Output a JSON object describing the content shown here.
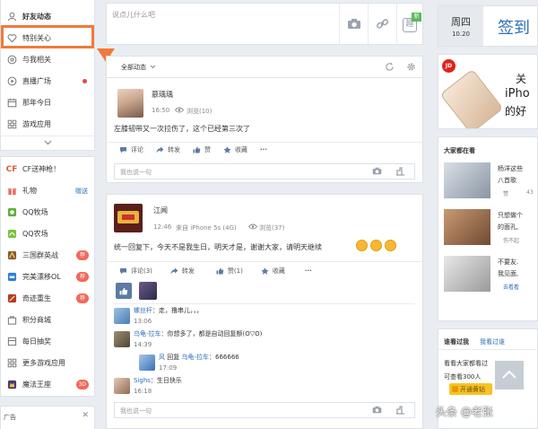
{
  "nav": {
    "items": [
      {
        "label": "好友动态"
      },
      {
        "label": "特别关心"
      },
      {
        "label": "与我相关"
      },
      {
        "label": "直播广场"
      },
      {
        "label": "那年今日"
      },
      {
        "label": "游戏应用"
      }
    ]
  },
  "apps": {
    "items": [
      {
        "label": "CF送神枪！",
        "badge": ""
      },
      {
        "label": "礼物",
        "badge": "赠送"
      },
      {
        "label": "QQ牧场",
        "badge": ""
      },
      {
        "label": "QQ农场",
        "badge": ""
      },
      {
        "label": "三国群英战",
        "badge": "荐"
      },
      {
        "label": "完美漂移OL",
        "badge": "荐"
      },
      {
        "label": "奇迹重生",
        "badge": "荐"
      },
      {
        "label": "积分商城",
        "badge": ""
      },
      {
        "label": "每日抽奖",
        "badge": ""
      },
      {
        "label": "更多游戏应用",
        "badge": ""
      },
      {
        "label": "魔法王座",
        "badge": "3D"
      }
    ]
  },
  "ad": {
    "label": "广告",
    "close": "✕"
  },
  "composer": {
    "placeholder": "说点儿什么吧",
    "app_badge": "新",
    "app_label": "趣"
  },
  "feed": {
    "filter_label": "全部动态"
  },
  "post1": {
    "user": "慕瑀瑀",
    "time": "16:50",
    "views": "浏览(10)",
    "text": "左膝韧带又一次拉伤了，这个已经第三次了",
    "actions": [
      "评论",
      "转发",
      "赞",
      "收藏",
      "···"
    ],
    "reply_placeholder": "我也说一句"
  },
  "post2": {
    "user": "江闻",
    "time": "12:46",
    "device": "来自 iPhone 5s (4G)",
    "views": "浏览(37)",
    "text": "统一回复下，今天不是我生日，明天才是，谢谢大家，请明天继续",
    "actions": [
      "评论(3)",
      "转发",
      "赞(1)",
      "收藏",
      "···"
    ],
    "comments": [
      {
        "name": "螺丝杆",
        "text": "：走，撸串儿，，，",
        "time": "13:06"
      },
      {
        "name": "乌龟-拉车",
        "text": "：你想多了，都是自动回复额(ʘ▽ʘ)",
        "time": "14:39"
      },
      {
        "name": "风",
        "reply": "回复",
        "to": "乌龟-拉车",
        "text": "：666666",
        "time": "17:09"
      },
      {
        "name": "Sighs",
        "text": "：生日快乐",
        "time": "16:18"
      }
    ],
    "reply_placeholder": "我也说一句"
  },
  "checkin": {
    "weekday": "周四",
    "date": "10.20",
    "label": "签到"
  },
  "promo": {
    "brand": "JD",
    "line1": "关",
    "line2": "iPho",
    "line3": "的好"
  },
  "watching": {
    "title": "大家都在看",
    "items": [
      {
        "text1": "杨洋这些",
        "text2": "八首歌",
        "meta": "赞",
        "count": "43"
      },
      {
        "text1": "只想做个",
        "text2": "的面孔,",
        "meta": "伤不起",
        "count": ""
      },
      {
        "text1": "不要友.",
        "text2": "我见面,",
        "meta": "去看看",
        "count": ""
      }
    ]
  },
  "visitors": {
    "tab1": "谁看过我",
    "tab2": "我看过谁",
    "text1": "看看大家都看过",
    "text2": "可查看300人",
    "button": "开通黄钻"
  },
  "watermark": {
    "text": "头条 @老张"
  },
  "colors": {
    "highlight": "#f07a3c",
    "link": "#2d6fb6",
    "badge": "#f06a5a",
    "vip": "#f7c325"
  }
}
